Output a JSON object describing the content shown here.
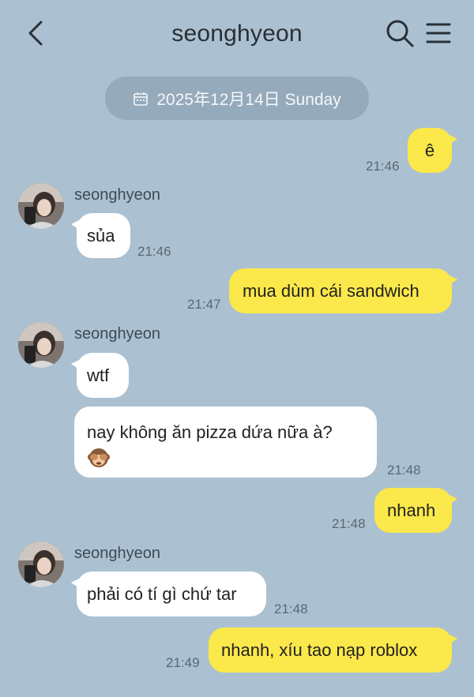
{
  "header": {
    "title": "seonghyeon"
  },
  "date_divider": "2025年12月14日 Sunday",
  "messages": [
    {
      "from": "me",
      "text": "ê",
      "time": "21:46"
    },
    {
      "from": "seonghyeon",
      "sender": "seonghyeon",
      "text": "sủa",
      "time": "21:46"
    },
    {
      "from": "me",
      "text": "mua dùm cái sandwich",
      "time": "21:47"
    },
    {
      "from": "seonghyeon",
      "sender": "seonghyeon",
      "text": "wtf"
    },
    {
      "from": "seonghyeon",
      "text": "nay không ăn pizza dứa nữa à?",
      "emoji": "see-no-evil-monkey",
      "time": "21:48"
    },
    {
      "from": "me",
      "text": "nhanh",
      "time": "21:48"
    },
    {
      "from": "seonghyeon",
      "sender": "seonghyeon",
      "text": "phải có tí gì chứ tar",
      "time": "21:48"
    },
    {
      "from": "me",
      "text": "nhanh, xíu tao nạp roblox",
      "time": "21:49"
    }
  ],
  "colors": {
    "background": "#abc1d1",
    "outgoing_bubble": "#fbe84a",
    "incoming_bubble": "#ffffff",
    "date_pill": "#95aabb"
  }
}
